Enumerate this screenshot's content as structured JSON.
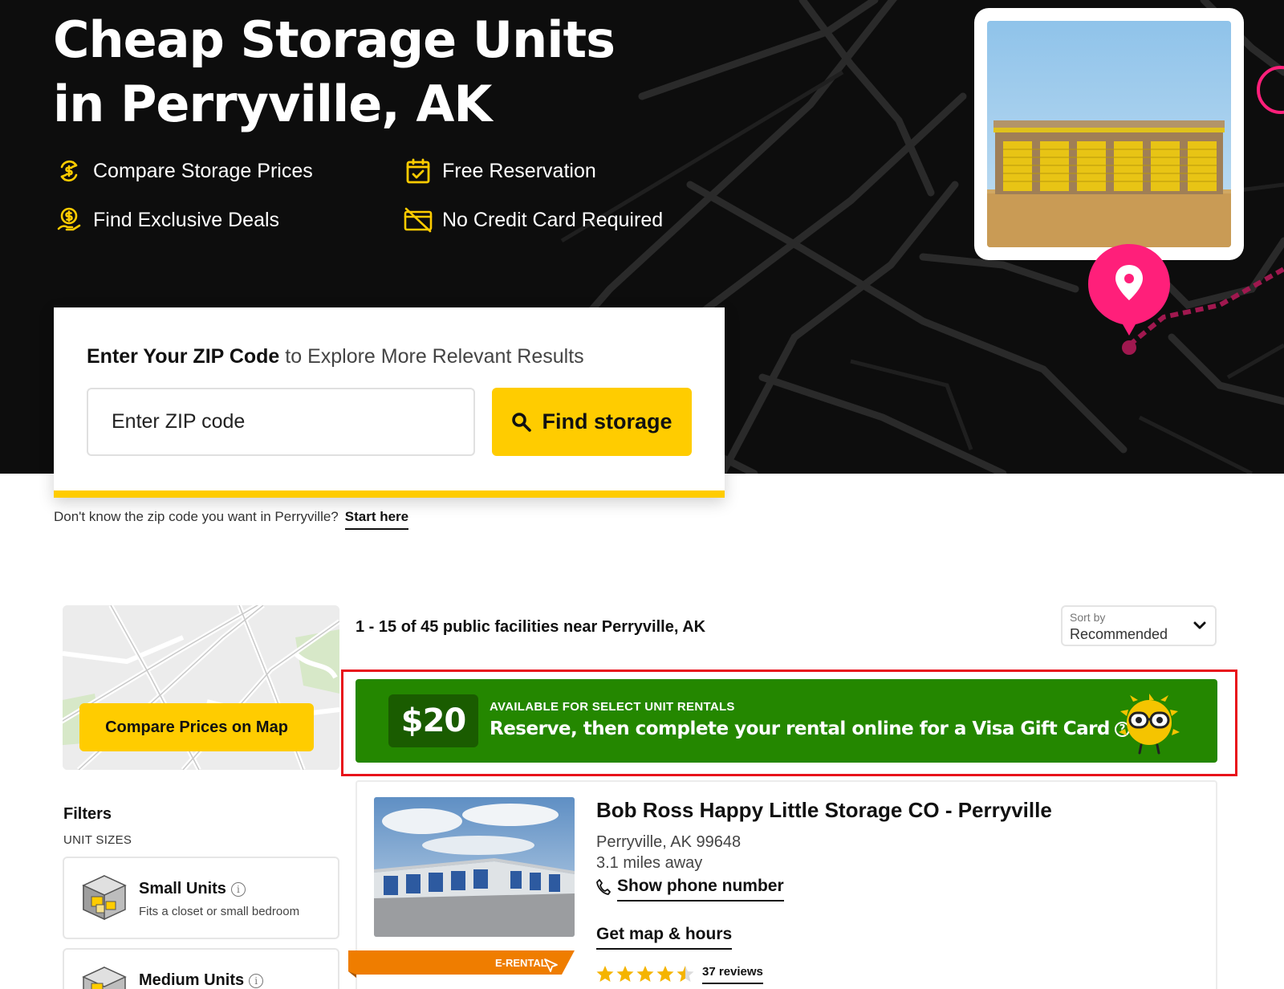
{
  "hero": {
    "title": "Cheap Storage Units in Perryville, AK",
    "features": [
      {
        "icon": "compare-arrows-icon",
        "label": "Compare Storage Prices"
      },
      {
        "icon": "calendar-check-icon",
        "label": "Free Reservation"
      },
      {
        "icon": "money-bag-icon",
        "label": "Find Exclusive Deals"
      },
      {
        "icon": "no-credit-card-icon",
        "label": "No Credit Card Required"
      }
    ]
  },
  "search": {
    "heading_bold": "Enter Your ZIP Code",
    "heading_rest": " to Explore More Relevant Results",
    "placeholder": "Enter ZIP code",
    "button_label": "Find storage",
    "hint": "Don't know the zip code you want in Perryville?",
    "hint_link": "Start here"
  },
  "sidebar": {
    "map_button": "Compare Prices on Map",
    "filters_title": "Filters",
    "unit_sizes_label": "UNIT SIZES",
    "units": [
      {
        "name": "Small Units",
        "desc": "Fits a closet or small bedroom"
      },
      {
        "name": "Medium Units",
        "desc": ""
      }
    ]
  },
  "results": {
    "count_text": "1 - 15 of 45 public facilities near Perryville, AK",
    "sort_label": "Sort by",
    "sort_value": "Recommended"
  },
  "promo": {
    "amount": "$20",
    "kicker": "AVAILABLE FOR SELECT UNIT RENTALS",
    "main": "Reserve, then complete your rental online for a Visa Gift Card",
    "help_icon": "?"
  },
  "facility": {
    "name": "Bob Ross Happy Little Storage CO - Perryville",
    "address": "Perryville, AK 99648",
    "distance": "3.1 miles away",
    "phone_label": "Show phone number",
    "map_label": "Get map & hours",
    "rating": 4.5,
    "reviews": "37 reviews",
    "badge": "E-RENTAL"
  },
  "colors": {
    "brand_yellow": "#ffcc00",
    "hero_bg": "#0d0d0d",
    "pin_pink": "#ff1f7a",
    "promo_green": "#248700",
    "highlight_red": "#e8111a"
  }
}
